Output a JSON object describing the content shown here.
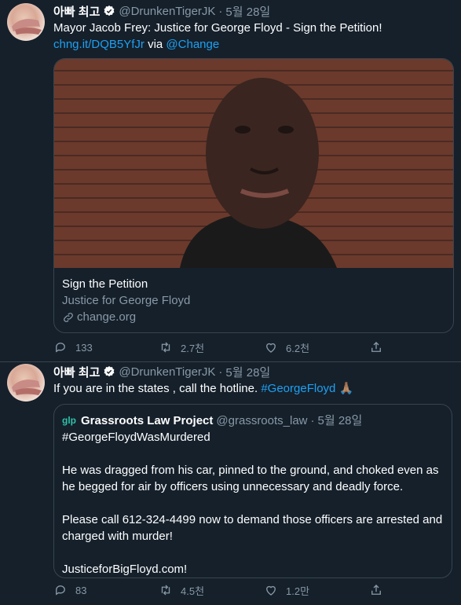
{
  "tweets": [
    {
      "name": "아빠 최고",
      "handle": "@DrunkenTigerJK",
      "dot": "·",
      "date": "5월 28일",
      "text": "Mayor Jacob Frey: Justice for George Floyd - Sign the Petition!",
      "link": "chng.it/DQB5YfJr",
      "via": "via",
      "mention": "@Change",
      "card": {
        "title": "Sign the Petition",
        "subtitle": "Justice for George Floyd",
        "domain": "change.org"
      },
      "actions": {
        "replies": "133",
        "retweets": "2.7천",
        "likes": "6.2천"
      }
    },
    {
      "name": "아빠 최고",
      "handle": "@DrunkenTigerJK",
      "dot": "·",
      "date": "5월 28일",
      "text": "If you are in the states , call the hotline.",
      "hashtag": "#GeorgeFloyd",
      "emoji": "🙏🏽",
      "quote": {
        "logo": "glp",
        "name": "Grassroots Law Project",
        "handle": "@grassroots_law",
        "dot": "·",
        "date": "5월 28일",
        "hashtag_line": "#GeorgeFloydWasMurdered",
        "paragraph1": "He was dragged from his car, pinned to the ground, and choked even as he begged for air by officers using unnecessary and deadly force.",
        "paragraph2": "Please call 612-324-4499 now to demand those officers are arrested and charged with murder!",
        "paragraph3": "JusticeforBigFloyd.com!"
      },
      "actions": {
        "replies": "83",
        "retweets": "4.5천",
        "likes": "1.2만"
      }
    }
  ],
  "icons": [
    "verified-badge-icon",
    "reply-icon",
    "retweet-icon",
    "like-icon",
    "share-icon",
    "link-icon"
  ],
  "colors": {
    "background": "#15202b",
    "link": "#1da1f2",
    "muted": "#8899a6",
    "border": "#38444d"
  }
}
